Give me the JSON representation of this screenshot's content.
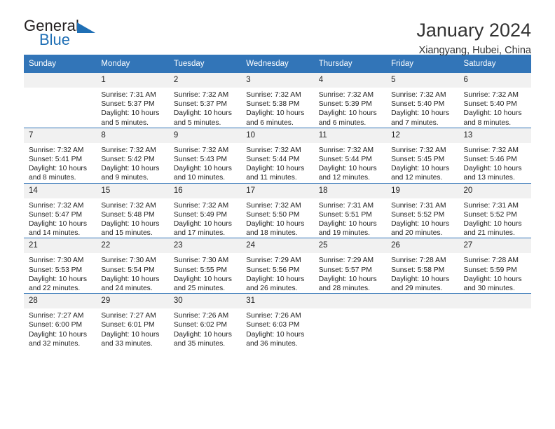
{
  "brand": {
    "word_one": "General",
    "word_two": "Blue",
    "triangle_icon": "triangle-icon"
  },
  "header": {
    "title": "January 2024",
    "subtitle": "Xiangyang, Hubei, China"
  },
  "colors": {
    "header_blue": "#3275b8",
    "daynum_band": "#f1f1f1",
    "brand_blue": "#1f6fb5",
    "text": "#222222"
  },
  "calendar": {
    "weekday_headers": [
      "Sunday",
      "Monday",
      "Tuesday",
      "Wednesday",
      "Thursday",
      "Friday",
      "Saturday"
    ],
    "weeks": [
      [
        {
          "day": "",
          "sunrise": "",
          "sunset": "",
          "daylight_line1": "",
          "daylight_line2": ""
        },
        {
          "day": "1",
          "sunrise": "Sunrise: 7:31 AM",
          "sunset": "Sunset: 5:37 PM",
          "daylight_line1": "Daylight: 10 hours",
          "daylight_line2": "and 5 minutes."
        },
        {
          "day": "2",
          "sunrise": "Sunrise: 7:32 AM",
          "sunset": "Sunset: 5:37 PM",
          "daylight_line1": "Daylight: 10 hours",
          "daylight_line2": "and 5 minutes."
        },
        {
          "day": "3",
          "sunrise": "Sunrise: 7:32 AM",
          "sunset": "Sunset: 5:38 PM",
          "daylight_line1": "Daylight: 10 hours",
          "daylight_line2": "and 6 minutes."
        },
        {
          "day": "4",
          "sunrise": "Sunrise: 7:32 AM",
          "sunset": "Sunset: 5:39 PM",
          "daylight_line1": "Daylight: 10 hours",
          "daylight_line2": "and 6 minutes."
        },
        {
          "day": "5",
          "sunrise": "Sunrise: 7:32 AM",
          "sunset": "Sunset: 5:40 PM",
          "daylight_line1": "Daylight: 10 hours",
          "daylight_line2": "and 7 minutes."
        },
        {
          "day": "6",
          "sunrise": "Sunrise: 7:32 AM",
          "sunset": "Sunset: 5:40 PM",
          "daylight_line1": "Daylight: 10 hours",
          "daylight_line2": "and 8 minutes."
        }
      ],
      [
        {
          "day": "7",
          "sunrise": "Sunrise: 7:32 AM",
          "sunset": "Sunset: 5:41 PM",
          "daylight_line1": "Daylight: 10 hours",
          "daylight_line2": "and 8 minutes."
        },
        {
          "day": "8",
          "sunrise": "Sunrise: 7:32 AM",
          "sunset": "Sunset: 5:42 PM",
          "daylight_line1": "Daylight: 10 hours",
          "daylight_line2": "and 9 minutes."
        },
        {
          "day": "9",
          "sunrise": "Sunrise: 7:32 AM",
          "sunset": "Sunset: 5:43 PM",
          "daylight_line1": "Daylight: 10 hours",
          "daylight_line2": "and 10 minutes."
        },
        {
          "day": "10",
          "sunrise": "Sunrise: 7:32 AM",
          "sunset": "Sunset: 5:44 PM",
          "daylight_line1": "Daylight: 10 hours",
          "daylight_line2": "and 11 minutes."
        },
        {
          "day": "11",
          "sunrise": "Sunrise: 7:32 AM",
          "sunset": "Sunset: 5:44 PM",
          "daylight_line1": "Daylight: 10 hours",
          "daylight_line2": "and 12 minutes."
        },
        {
          "day": "12",
          "sunrise": "Sunrise: 7:32 AM",
          "sunset": "Sunset: 5:45 PM",
          "daylight_line1": "Daylight: 10 hours",
          "daylight_line2": "and 12 minutes."
        },
        {
          "day": "13",
          "sunrise": "Sunrise: 7:32 AM",
          "sunset": "Sunset: 5:46 PM",
          "daylight_line1": "Daylight: 10 hours",
          "daylight_line2": "and 13 minutes."
        }
      ],
      [
        {
          "day": "14",
          "sunrise": "Sunrise: 7:32 AM",
          "sunset": "Sunset: 5:47 PM",
          "daylight_line1": "Daylight: 10 hours",
          "daylight_line2": "and 14 minutes."
        },
        {
          "day": "15",
          "sunrise": "Sunrise: 7:32 AM",
          "sunset": "Sunset: 5:48 PM",
          "daylight_line1": "Daylight: 10 hours",
          "daylight_line2": "and 15 minutes."
        },
        {
          "day": "16",
          "sunrise": "Sunrise: 7:32 AM",
          "sunset": "Sunset: 5:49 PM",
          "daylight_line1": "Daylight: 10 hours",
          "daylight_line2": "and 17 minutes."
        },
        {
          "day": "17",
          "sunrise": "Sunrise: 7:32 AM",
          "sunset": "Sunset: 5:50 PM",
          "daylight_line1": "Daylight: 10 hours",
          "daylight_line2": "and 18 minutes."
        },
        {
          "day": "18",
          "sunrise": "Sunrise: 7:31 AM",
          "sunset": "Sunset: 5:51 PM",
          "daylight_line1": "Daylight: 10 hours",
          "daylight_line2": "and 19 minutes."
        },
        {
          "day": "19",
          "sunrise": "Sunrise: 7:31 AM",
          "sunset": "Sunset: 5:52 PM",
          "daylight_line1": "Daylight: 10 hours",
          "daylight_line2": "and 20 minutes."
        },
        {
          "day": "20",
          "sunrise": "Sunrise: 7:31 AM",
          "sunset": "Sunset: 5:52 PM",
          "daylight_line1": "Daylight: 10 hours",
          "daylight_line2": "and 21 minutes."
        }
      ],
      [
        {
          "day": "21",
          "sunrise": "Sunrise: 7:30 AM",
          "sunset": "Sunset: 5:53 PM",
          "daylight_line1": "Daylight: 10 hours",
          "daylight_line2": "and 22 minutes."
        },
        {
          "day": "22",
          "sunrise": "Sunrise: 7:30 AM",
          "sunset": "Sunset: 5:54 PM",
          "daylight_line1": "Daylight: 10 hours",
          "daylight_line2": "and 24 minutes."
        },
        {
          "day": "23",
          "sunrise": "Sunrise: 7:30 AM",
          "sunset": "Sunset: 5:55 PM",
          "daylight_line1": "Daylight: 10 hours",
          "daylight_line2": "and 25 minutes."
        },
        {
          "day": "24",
          "sunrise": "Sunrise: 7:29 AM",
          "sunset": "Sunset: 5:56 PM",
          "daylight_line1": "Daylight: 10 hours",
          "daylight_line2": "and 26 minutes."
        },
        {
          "day": "25",
          "sunrise": "Sunrise: 7:29 AM",
          "sunset": "Sunset: 5:57 PM",
          "daylight_line1": "Daylight: 10 hours",
          "daylight_line2": "and 28 minutes."
        },
        {
          "day": "26",
          "sunrise": "Sunrise: 7:28 AM",
          "sunset": "Sunset: 5:58 PM",
          "daylight_line1": "Daylight: 10 hours",
          "daylight_line2": "and 29 minutes."
        },
        {
          "day": "27",
          "sunrise": "Sunrise: 7:28 AM",
          "sunset": "Sunset: 5:59 PM",
          "daylight_line1": "Daylight: 10 hours",
          "daylight_line2": "and 30 minutes."
        }
      ],
      [
        {
          "day": "28",
          "sunrise": "Sunrise: 7:27 AM",
          "sunset": "Sunset: 6:00 PM",
          "daylight_line1": "Daylight: 10 hours",
          "daylight_line2": "and 32 minutes."
        },
        {
          "day": "29",
          "sunrise": "Sunrise: 7:27 AM",
          "sunset": "Sunset: 6:01 PM",
          "daylight_line1": "Daylight: 10 hours",
          "daylight_line2": "and 33 minutes."
        },
        {
          "day": "30",
          "sunrise": "Sunrise: 7:26 AM",
          "sunset": "Sunset: 6:02 PM",
          "daylight_line1": "Daylight: 10 hours",
          "daylight_line2": "and 35 minutes."
        },
        {
          "day": "31",
          "sunrise": "Sunrise: 7:26 AM",
          "sunset": "Sunset: 6:03 PM",
          "daylight_line1": "Daylight: 10 hours",
          "daylight_line2": "and 36 minutes."
        },
        {
          "day": "",
          "sunrise": "",
          "sunset": "",
          "daylight_line1": "",
          "daylight_line2": ""
        },
        {
          "day": "",
          "sunrise": "",
          "sunset": "",
          "daylight_line1": "",
          "daylight_line2": ""
        },
        {
          "day": "",
          "sunrise": "",
          "sunset": "",
          "daylight_line1": "",
          "daylight_line2": ""
        }
      ]
    ]
  }
}
